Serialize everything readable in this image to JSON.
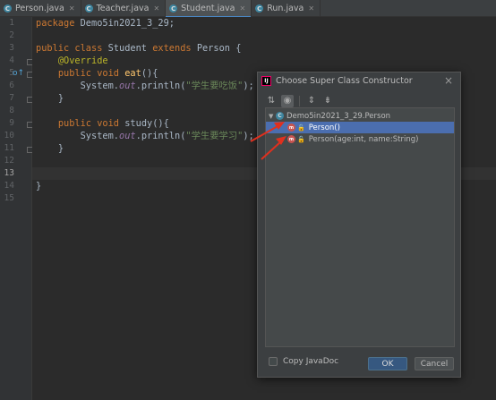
{
  "tabs": [
    {
      "label": "Person.java",
      "active": false
    },
    {
      "label": "Teacher.java",
      "active": false
    },
    {
      "label": "Student.java",
      "active": true
    },
    {
      "label": "Run.java",
      "active": false
    }
  ],
  "gutter": {
    "line_numbers": [
      "1",
      "2",
      "3",
      "4",
      "5",
      "6",
      "7",
      "8",
      "9",
      "10",
      "11",
      "12",
      "13",
      "14",
      "15"
    ],
    "current_line": "13"
  },
  "code": {
    "l1_kw": "package ",
    "l1_text": "Demo5in2021_3_29;",
    "l3_kw1": "public class ",
    "l3_name": "Student ",
    "l3_kw2": "extends ",
    "l3_super": "Person {",
    "l4_ann": "@Override",
    "l5_kw": "public void ",
    "l5_fn": "eat",
    "l5_rest": "(){",
    "l6_obj": "System.",
    "l6_fld": "out",
    "l6_call": ".println(",
    "l6_str": "\"学生要吃饭\"",
    "l6_end": ");",
    "l7": "}",
    "l9_kw": "public void ",
    "l9_name": "study(){",
    "l10_obj": "System.",
    "l10_fld": "out",
    "l10_call": ".println(",
    "l10_str": "\"学生要学习\"",
    "l10_end": ");",
    "l11": "}",
    "l14": "}"
  },
  "dialog": {
    "title": "Choose Super Class Constructor",
    "close_glyph": "×",
    "toolbar": {
      "sort_glyph": "⇅",
      "toggle_glyph": "◉",
      "expand_glyph": "⇕",
      "collapse_glyph": "⇟"
    },
    "tree": {
      "root": {
        "label": "Demo5in2021_3_29.Person",
        "icon": "C"
      },
      "items": [
        {
          "label": "Person()",
          "selected": true,
          "icon": "m"
        },
        {
          "label": "Person(age:int, name:String)",
          "selected": false,
          "icon": "m"
        }
      ]
    },
    "copy_javadoc_label": "Copy JavaDoc",
    "ok_label": "OK",
    "cancel_label": "Cancel"
  },
  "colors": {
    "arrow": "#e0301e",
    "selection": "#4b6eaf",
    "keyword": "#cc7832",
    "string": "#6a8759"
  }
}
